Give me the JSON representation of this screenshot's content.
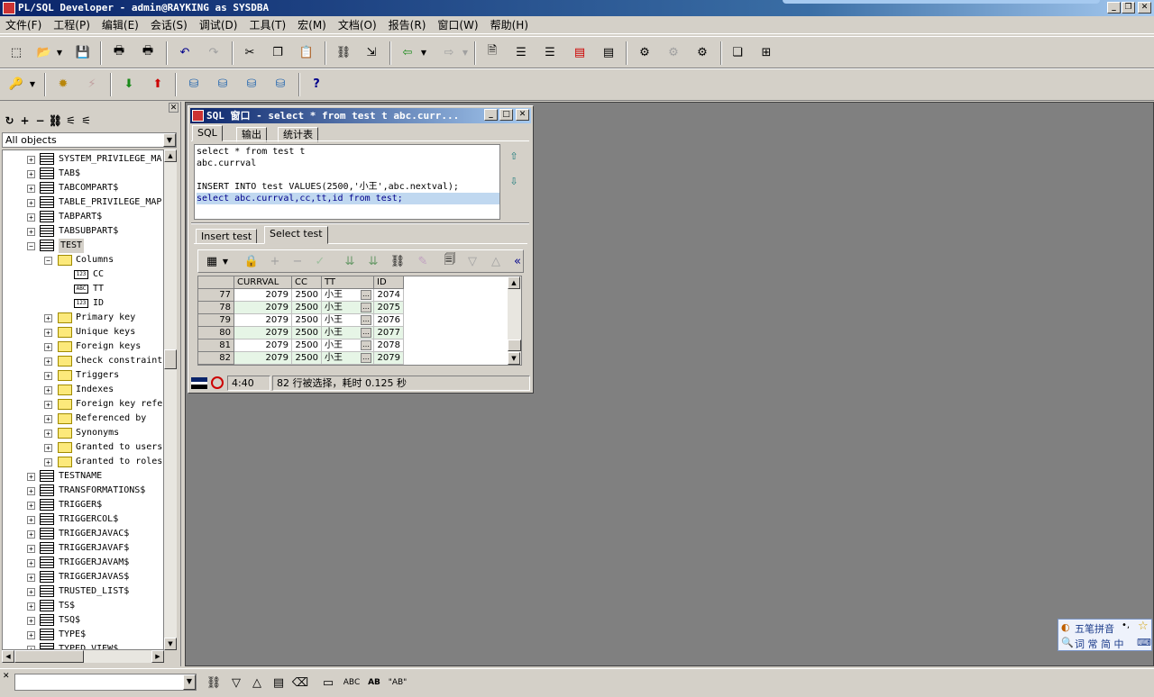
{
  "app": {
    "title": "PL/SQL Developer - admin@RAYKING as SYSDBA",
    "win_buttons": [
      "_",
      "❐",
      "✕"
    ]
  },
  "menu": [
    "文件(F)",
    "工程(P)",
    "编辑(E)",
    "会话(S)",
    "调试(D)",
    "工具(T)",
    "宏(M)",
    "文档(O)",
    "报告(R)",
    "窗口(W)",
    "帮助(H)"
  ],
  "browser": {
    "selector_value": "All objects",
    "tree": [
      {
        "label": "SYSTEM_PRIVILEGE_MA",
        "kind": "table",
        "expanded": false
      },
      {
        "label": "TAB$",
        "kind": "table",
        "expanded": false
      },
      {
        "label": "TABCOMPART$",
        "kind": "table",
        "expanded": false
      },
      {
        "label": "TABLE_PRIVILEGE_MAP",
        "kind": "table",
        "expanded": false
      },
      {
        "label": "TABPART$",
        "kind": "table",
        "expanded": false
      },
      {
        "label": "TABSUBPART$",
        "kind": "table",
        "expanded": false
      },
      {
        "label": "TEST",
        "kind": "table",
        "expanded": true,
        "selected": true
      },
      {
        "label": "Columns",
        "kind": "folder-open",
        "level": 1
      },
      {
        "label": "CC",
        "kind": "col",
        "badge": "123",
        "level": 2
      },
      {
        "label": "TT",
        "kind": "col",
        "badge": "ABC",
        "level": 2
      },
      {
        "label": "ID",
        "kind": "col",
        "badge": "123",
        "level": 2
      },
      {
        "label": "Primary key",
        "kind": "folder",
        "level": 1
      },
      {
        "label": "Unique keys",
        "kind": "folder",
        "level": 1
      },
      {
        "label": "Foreign keys",
        "kind": "folder",
        "level": 1
      },
      {
        "label": "Check constraint",
        "kind": "folder",
        "level": 1
      },
      {
        "label": "Triggers",
        "kind": "folder",
        "level": 1
      },
      {
        "label": "Indexes",
        "kind": "folder",
        "level": 1
      },
      {
        "label": "Foreign key refe",
        "kind": "folder",
        "level": 1
      },
      {
        "label": "Referenced by",
        "kind": "folder",
        "level": 1
      },
      {
        "label": "Synonyms",
        "kind": "folder",
        "level": 1
      },
      {
        "label": "Granted to users",
        "kind": "folder",
        "level": 1
      },
      {
        "label": "Granted to roles",
        "kind": "folder",
        "level": 1
      },
      {
        "label": "TESTNAME",
        "kind": "table"
      },
      {
        "label": "TRANSFORMATIONS$",
        "kind": "table"
      },
      {
        "label": "TRIGGER$",
        "kind": "table"
      },
      {
        "label": "TRIGGERCOL$",
        "kind": "table"
      },
      {
        "label": "TRIGGERJAVAC$",
        "kind": "table"
      },
      {
        "label": "TRIGGERJAVAF$",
        "kind": "table"
      },
      {
        "label": "TRIGGERJAVAM$",
        "kind": "table"
      },
      {
        "label": "TRIGGERJAVAS$",
        "kind": "table"
      },
      {
        "label": "TRUSTED_LIST$",
        "kind": "table"
      },
      {
        "label": "TS$",
        "kind": "table"
      },
      {
        "label": "TSQ$",
        "kind": "table"
      },
      {
        "label": "TYPE$",
        "kind": "table"
      },
      {
        "label": "TYPED_VIEW$",
        "kind": "table"
      }
    ]
  },
  "sql_window": {
    "title": "SQL 窗口 - select * from test t abc.curr...",
    "tabs": [
      "SQL",
      "输出",
      "统计表"
    ],
    "editor_lines": [
      {
        "text": "select * from test t",
        "hl": false
      },
      {
        "text": "abc.currval",
        "hl": false
      },
      {
        "text": "",
        "hl": false
      },
      {
        "text": "INSERT INTO test VALUES(2500,'小王',abc.nextval);",
        "hl": false
      },
      {
        "text": "select abc.currval,cc,tt,id from test;",
        "hl": true
      }
    ],
    "result_tabs": [
      "Insert test",
      "Select test"
    ],
    "grid": {
      "columns": [
        "CURRVAL",
        "CC",
        "TT",
        "ID"
      ],
      "rows": [
        {
          "n": "77",
          "currval": "2079",
          "cc": "2500",
          "tt": "小王",
          "id": "2074"
        },
        {
          "n": "78",
          "currval": "2079",
          "cc": "2500",
          "tt": "小王",
          "id": "2075"
        },
        {
          "n": "79",
          "currval": "2079",
          "cc": "2500",
          "tt": "小王",
          "id": "2076"
        },
        {
          "n": "80",
          "currval": "2079",
          "cc": "2500",
          "tt": "小王",
          "id": "2077"
        },
        {
          "n": "81",
          "currval": "2079",
          "cc": "2500",
          "tt": "小王",
          "id": "2078"
        },
        {
          "n": "82",
          "currval": "2079",
          "cc": "2500",
          "tt": "小王",
          "id": "2079"
        }
      ]
    },
    "status": {
      "position": "4:40",
      "message": "82 行被选择，耗时 0.125 秒"
    }
  },
  "ime": {
    "line1": "五笔拼音",
    "line2": "词 常 简 中"
  },
  "find_bar": {
    "search_value": ""
  }
}
